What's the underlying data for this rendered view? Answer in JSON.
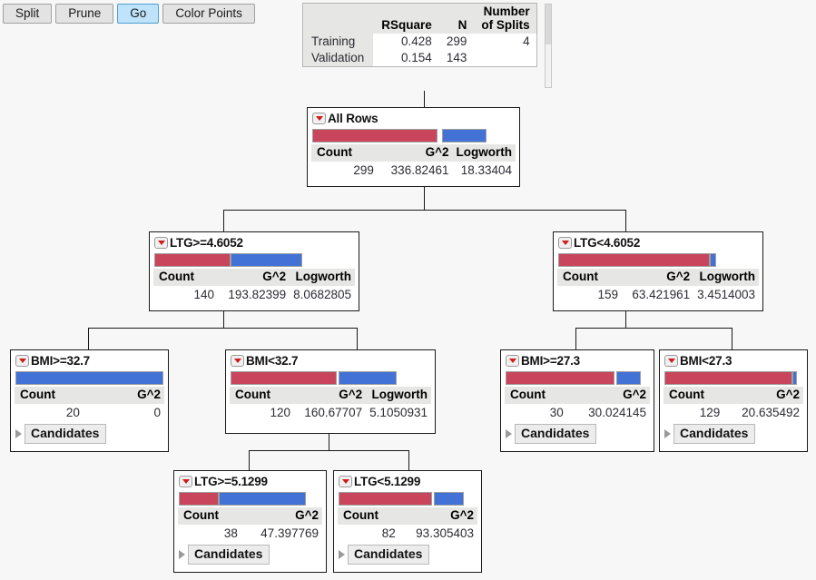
{
  "toolbar": {
    "buttons": [
      {
        "label": "Split",
        "active": false
      },
      {
        "label": "Prune",
        "active": false
      },
      {
        "label": "Go",
        "active": true
      },
      {
        "label": "Color Points",
        "active": false
      }
    ]
  },
  "summary": {
    "columns": [
      "",
      "RSquare",
      "N",
      "Number of Splits"
    ],
    "rows": [
      {
        "name": "Training",
        "rsquare": "0.428",
        "n": "299",
        "splits": "4"
      },
      {
        "name": "Validation",
        "rsquare": "0.154",
        "n": "143",
        "splits": ""
      }
    ]
  },
  "colors": {
    "red": "#c9455c",
    "blue": "#4272d6",
    "header_gray": "#e6e6e4",
    "accent_blue": "#bfe3fa",
    "marker_red": "#d01b1b"
  },
  "labels": {
    "count": "Count",
    "g2": "G^2",
    "logworth": "Logworth",
    "candidates": "Candidates"
  },
  "tree": {
    "nodes": [
      {
        "id": "all-rows",
        "title": "All Rows",
        "count": "299",
        "g2": "336.82461",
        "logworth": "18.33404",
        "bar": {
          "red_pct": 62,
          "blue_pct": 22
        },
        "candidates": false
      },
      {
        "id": "ltg-ge-4-6052",
        "title": "LTG>=4.6052",
        "count": "140",
        "g2": "193.82399",
        "logworth": "8.0682805",
        "bar": {
          "red_pct": 38,
          "blue_pct": 36
        },
        "candidates": false
      },
      {
        "id": "ltg-lt-4-6052",
        "title": "LTG<4.6052",
        "count": "159",
        "g2": "63.421961",
        "logworth": "3.4514003",
        "bar": {
          "red_pct": 76,
          "blue_pct": 3
        },
        "candidates": false
      },
      {
        "id": "bmi-ge-32-7",
        "title": "BMI>=32.7",
        "count": "20",
        "g2": "0",
        "logworth": null,
        "bar": {
          "red_pct": 0,
          "blue_pct": 100
        },
        "candidates": true
      },
      {
        "id": "bmi-lt-32-7",
        "title": "BMI<32.7",
        "count": "120",
        "g2": "160.67707",
        "logworth": "5.1050931",
        "bar": {
          "red_pct": 53,
          "blue_pct": 29
        },
        "candidates": false
      },
      {
        "id": "bmi-ge-27-3",
        "title": "BMI>=27.3",
        "count": "30",
        "g2": "30.024145",
        "logworth": null,
        "bar": {
          "red_pct": 76,
          "blue_pct": 17
        },
        "candidates": true
      },
      {
        "id": "bmi-lt-27-3",
        "title": "BMI<27.3",
        "count": "129",
        "g2": "20.635492",
        "logworth": null,
        "bar": {
          "red_pct": 93,
          "blue_pct": 3
        },
        "candidates": true
      },
      {
        "id": "ltg-ge-5-1299",
        "title": "LTG>=5.1299",
        "count": "38",
        "g2": "47.397769",
        "logworth": null,
        "bar": {
          "red_pct": 28,
          "blue_pct": 61
        },
        "candidates": true
      },
      {
        "id": "ltg-lt-5-1299",
        "title": "LTG<5.1299",
        "count": "82",
        "g2": "93.305403",
        "logworth": null,
        "bar": {
          "red_pct": 68,
          "blue_pct": 22
        },
        "candidates": true
      }
    ]
  }
}
